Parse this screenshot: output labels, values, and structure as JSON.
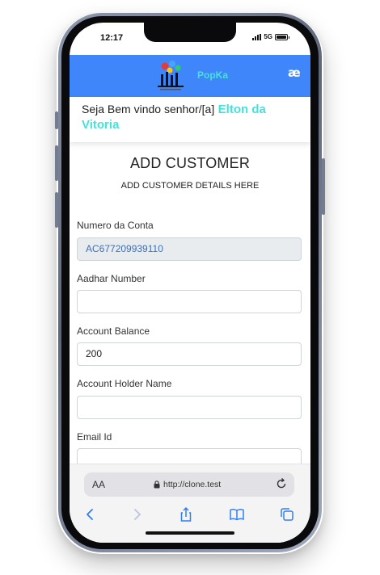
{
  "status_bar": {
    "time": "12:17",
    "network": "5G"
  },
  "navbar": {
    "brand": "PopKa",
    "menu_icon": "hamburger-logo-icon"
  },
  "welcome": {
    "greeting": "Seja Bem vindo senhor/[a]",
    "user_name": "Elton da Vitoria"
  },
  "page": {
    "title": "ADD CUSTOMER",
    "subtitle": "ADD CUSTOMER DETAILS HERE"
  },
  "form": {
    "account_number": {
      "label": "Numero da Conta",
      "value": "AC677209939110"
    },
    "aadhar": {
      "label": "Aadhar Number",
      "value": ""
    },
    "balance": {
      "label": "Account Balance",
      "value": "200"
    },
    "holder_name": {
      "label": "Account Holder Name",
      "value": ""
    },
    "email": {
      "label": "Email Id",
      "value": ""
    }
  },
  "browser": {
    "text_size_label": "AA",
    "url": "http://clone.test",
    "icons": [
      "back-icon",
      "forward-icon",
      "share-icon",
      "bookmarks-icon",
      "tabs-icon"
    ]
  },
  "colors": {
    "navbar": "#3f86fb",
    "accent": "#44e3da",
    "readonly_field": "#e9ecef"
  }
}
